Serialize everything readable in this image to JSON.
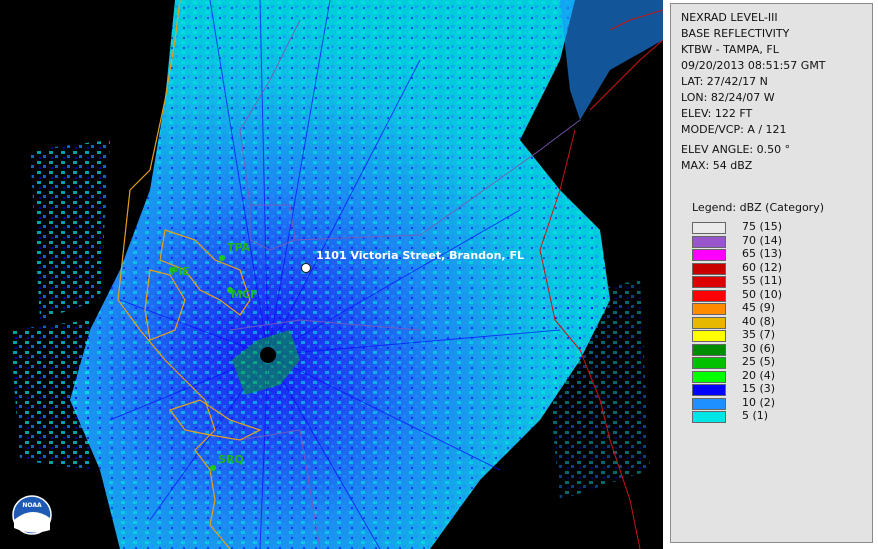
{
  "info": {
    "lines_top": [
      "NEXRAD LEVEL-III",
      "BASE REFLECTIVITY",
      "KTBW - TAMPA, FL",
      "09/20/2013 08:51:57 GMT",
      "LAT: 27/42/17 N",
      "LON: 82/24/07 W",
      "ELEV: 122 FT",
      "MODE/VCP: A / 121"
    ],
    "elev_angle": "ELEV ANGLE: 0.50 °",
    "max": "MAX: 54 dBZ",
    "legend_title": "Legend: dBZ (Category)"
  },
  "legend": [
    {
      "label": "75  (15)",
      "color": "#ecebec"
    },
    {
      "label": "70  (14)",
      "color": "#9955cc"
    },
    {
      "label": "65  (13)",
      "color": "#ff00ff"
    },
    {
      "label": "60  (12)",
      "color": "#c80000"
    },
    {
      "label": "55  (11)",
      "color": "#dd0000"
    },
    {
      "label": "50  (10)",
      "color": "#ff0000"
    },
    {
      "label": "45  (9)",
      "color": "#ff8c00"
    },
    {
      "label": "40  (8)",
      "color": "#e6b800"
    },
    {
      "label": "35  (7)",
      "color": "#ffff00"
    },
    {
      "label": "30  (6)",
      "color": "#008c00"
    },
    {
      "label": "25  (5)",
      "color": "#00c000"
    },
    {
      "label": "20  (4)",
      "color": "#00ff00"
    },
    {
      "label": "15  (3)",
      "color": "#0000ff"
    },
    {
      "label": "10  (2)",
      "color": "#1e90ff"
    },
    {
      "label": "5  (1)",
      "color": "#00e6e6"
    }
  ],
  "map": {
    "location_label": "1101 Victoria Street, Brandon, FL",
    "city_labels": [
      "TPA",
      "PIE",
      "MCF",
      "SRQ"
    ],
    "logo_text": "NOAA"
  }
}
